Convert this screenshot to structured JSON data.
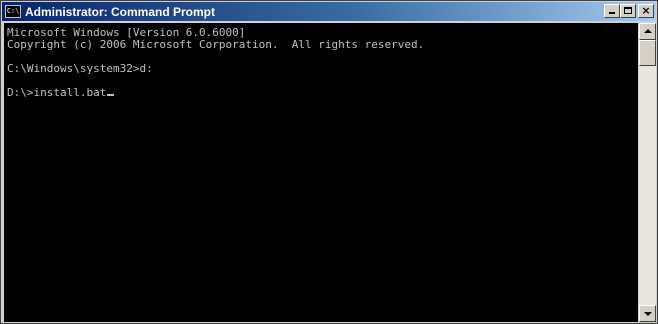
{
  "window": {
    "title": "Administrator: Command Prompt",
    "icon_label": "C:\\",
    "buttons": [
      "minimize",
      "maximize",
      "close"
    ],
    "close_glyph": "×"
  },
  "console": {
    "lines": [
      "Microsoft Windows [Version 6.0.6000]",
      "Copyright (c) 2006 Microsoft Corporation.  All rights reserved.",
      "",
      "C:\\Windows\\system32>d:",
      "",
      "D:\\>install.bat"
    ],
    "background_color": "#000000",
    "text_color": "#c0c0c0"
  },
  "scrollbar": {
    "position_fraction": 0.0
  },
  "colors": {
    "titlebar_start": "#0a246a",
    "titlebar_end": "#a6caf0",
    "chrome": "#d4d0c8"
  }
}
